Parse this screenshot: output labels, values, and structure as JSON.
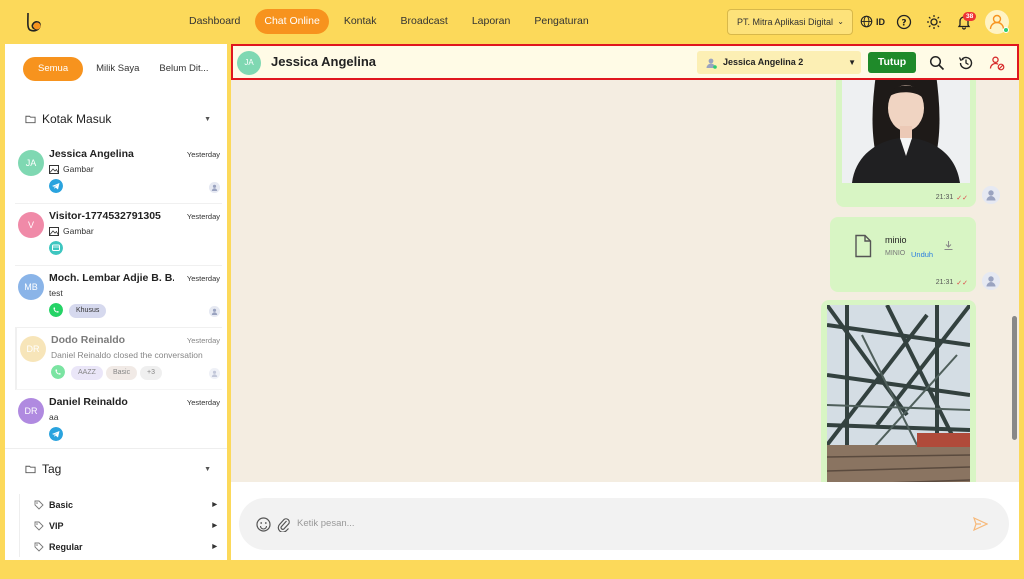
{
  "nav": {
    "items": [
      "Dashboard",
      "Chat Online",
      "Kontak",
      "Broadcast",
      "Laporan",
      "Pengaturan"
    ],
    "active": "Chat Online",
    "org": "PT. Mitra Aplikasi Digital",
    "lang": "ID",
    "notif_count": "38"
  },
  "sidebar": {
    "tabs": [
      "Semua",
      "Milik Saya",
      "Belum Dit..."
    ],
    "inbox_label": "Kotak Masuk",
    "tag_label": "Tag",
    "conversations": [
      {
        "initials": "JA",
        "name": "Jessica Angelina",
        "time": "Yesterday",
        "message": "Gambar",
        "channel": "telegram",
        "color": "#7fd8b2"
      },
      {
        "initials": "V",
        "name": "Visitor-1774532791305",
        "time": "Yesterday",
        "message": "Gambar",
        "channel": "web",
        "color": "#f08aa8"
      },
      {
        "initials": "MB",
        "name": "Moch. Lembar Adjie B. B...",
        "time": "Yesterday",
        "message": "test",
        "channel": "whatsapp",
        "color": "#8ab4e8",
        "tags": [
          "Khusus"
        ]
      },
      {
        "initials": "DR",
        "name": "Dodo Reinaldo",
        "time": "Yesterday",
        "message": "Daniel Reinaldo closed the conversation",
        "channel": "whatsapp",
        "color": "#f3d48c",
        "tags": [
          "AAZZ",
          "Basic",
          "+3"
        ]
      },
      {
        "initials": "DR",
        "name": "Daniel Reinaldo",
        "time": "Yesterday",
        "message": "aa",
        "channel": "telegram",
        "color": "#b08ae0"
      }
    ],
    "tags": [
      "Basic",
      "VIP",
      "Regular"
    ]
  },
  "chat": {
    "contact_initials": "JA",
    "contact_name": "Jessica Angelina",
    "agent": "Jessica Angelina 2",
    "close_label": "Tutup",
    "messages": [
      {
        "type": "image",
        "time": "21:31"
      },
      {
        "type": "file",
        "filename": "minio",
        "sub": "MINIO",
        "download": "Unduh",
        "time": "21:31"
      },
      {
        "type": "image"
      }
    ],
    "composer_placeholder": "Ketik pesan..."
  },
  "colors": {
    "accent": "#f7931e",
    "brand_bg": "#fcd95a",
    "success": "#1f8a2a",
    "highlight": "#e0161e"
  }
}
